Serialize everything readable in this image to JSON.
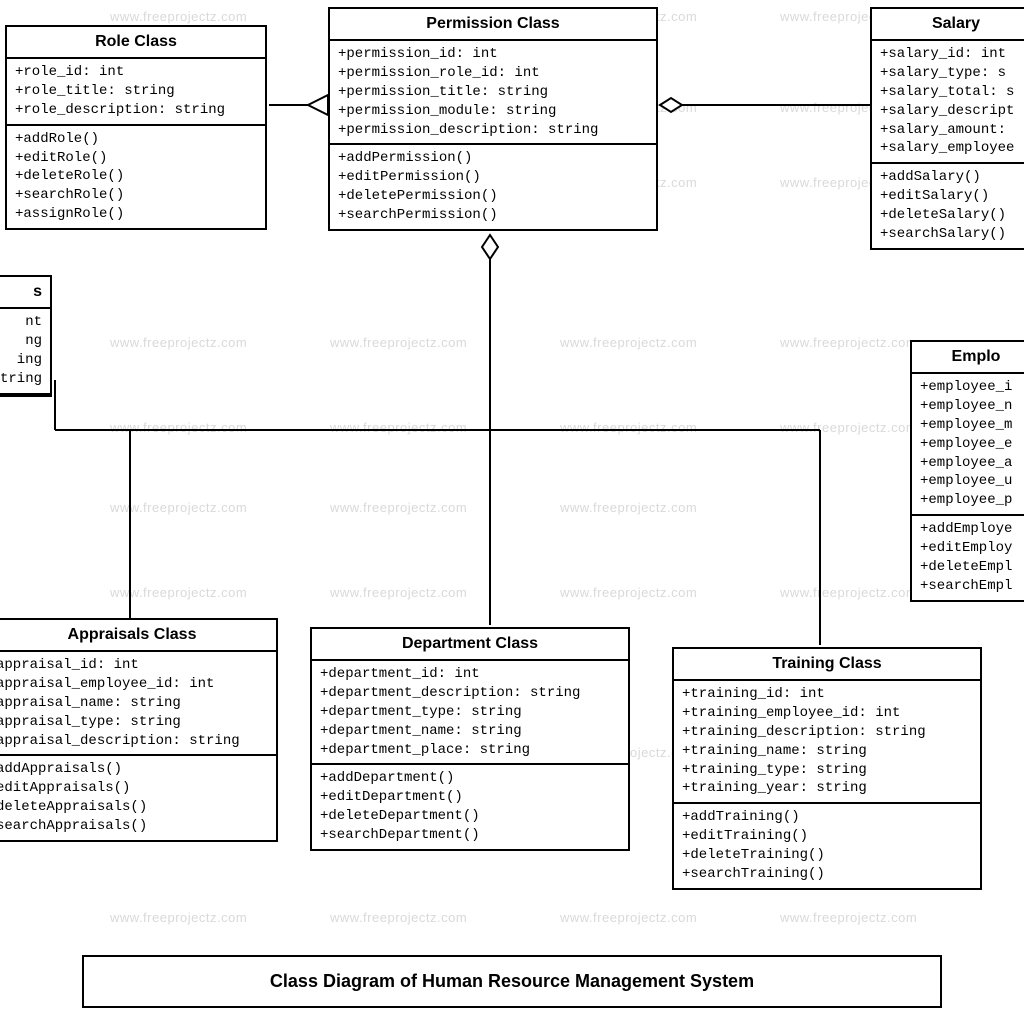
{
  "diagram_title": "Class Diagram of Human Resource Management System",
  "watermark": "www.freeprojectz.com",
  "classes": {
    "role": {
      "title": "Role Class",
      "attrs": [
        "+role_id: int",
        "+role_title: string",
        "+role_description: string"
      ],
      "methods": [
        "+addRole()",
        "+editRole()",
        "+deleteRole()",
        "+searchRole()",
        "+assignRole()"
      ]
    },
    "permission": {
      "title": "Permission Class",
      "attrs": [
        "+permission_id: int",
        "+permission_role_id: int",
        "+permission_title: string",
        "+permission_module: string",
        "+permission_description: string"
      ],
      "methods": [
        "+addPermission()",
        "+editPermission()",
        "+deletePermission()",
        "+searchPermission()"
      ]
    },
    "salary": {
      "title": "Salary",
      "attrs": [
        "+salary_id: int",
        "+salary_type: s",
        "+salary_total: s",
        "+salary_descript",
        "+salary_amount:",
        "+salary_employee"
      ],
      "methods": [
        "+addSalary()",
        "+editSalary()",
        "+deleteSalary()",
        "+searchSalary()"
      ]
    },
    "partial_left": {
      "title": "s",
      "attrs": [
        "nt",
        "ng",
        "ing",
        " ",
        "tring"
      ],
      "methods": []
    },
    "employee": {
      "title": "Emplo",
      "attrs": [
        "+employee_i",
        "+employee_n",
        "+employee_m",
        "+employee_e",
        "+employee_a",
        "+employee_u",
        "+employee_p"
      ],
      "methods": [
        "+addEmploye",
        "+editEmploy",
        "+deleteEmpl",
        "+searchEmpl"
      ]
    },
    "appraisals": {
      "title": "Appraisals Class",
      "attrs": [
        "appraisal_id: int",
        "appraisal_employee_id: int",
        "appraisal_name: string",
        "appraisal_type: string",
        "appraisal_description: string"
      ],
      "methods": [
        "addAppraisals()",
        "editAppraisals()",
        "deleteAppraisals()",
        "searchAppraisals()"
      ]
    },
    "department": {
      "title": "Department Class",
      "attrs": [
        "+department_id: int",
        "+department_description: string",
        "+department_type: string",
        "+department_name: string",
        "+department_place: string"
      ],
      "methods": [
        "+addDepartment()",
        "+editDepartment()",
        "+deleteDepartment()",
        "+searchDepartment()"
      ]
    },
    "training": {
      "title": "Training Class",
      "attrs": [
        "+training_id: int",
        "+training_employee_id: int",
        "+training_description: string",
        "+training_name: string",
        "+training_type: string",
        "+training_year: string"
      ],
      "methods": [
        "+addTraining()",
        "+editTraining()",
        "+deleteTraining()",
        "+searchTraining()"
      ]
    }
  }
}
